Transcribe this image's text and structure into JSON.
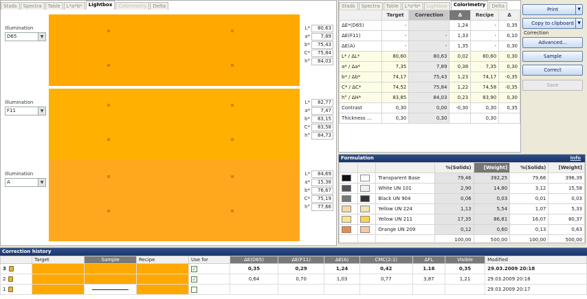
{
  "left_tabs": [
    {
      "label": "Stads",
      "state": "normal"
    },
    {
      "label": "Spectra",
      "state": "normal"
    },
    {
      "label": "Table",
      "state": "normal"
    },
    {
      "label": "L*a*b*",
      "state": "normal"
    },
    {
      "label": "Lightbox",
      "state": "active"
    },
    {
      "label": "Colorimetry",
      "state": "disabled"
    },
    {
      "label": "Delta",
      "state": "normal"
    }
  ],
  "right_tabs": [
    {
      "label": "Stads",
      "state": "normal"
    },
    {
      "label": "Spectra",
      "state": "normal"
    },
    {
      "label": "Table",
      "state": "normal"
    },
    {
      "label": "L*a*b*",
      "state": "normal"
    },
    {
      "label": "Lightbox",
      "state": "disabled"
    },
    {
      "label": "Colorimetry",
      "state": "active"
    },
    {
      "label": "Delta",
      "state": "normal"
    }
  ],
  "illuminants": [
    {
      "label": "Illumination",
      "value": "D65",
      "color": "#ffa800",
      "lab": [
        {
          "k": "L*",
          "v": "80,63"
        },
        {
          "k": "a*",
          "v": "7,89"
        },
        {
          "k": "b*",
          "v": "75,43"
        },
        {
          "k": "C*",
          "v": "75,84"
        },
        {
          "k": "h°",
          "v": "84,03"
        }
      ]
    },
    {
      "label": "Illumination",
      "value": "F11",
      "color": "#ffb000",
      "lab": [
        {
          "k": "L*",
          "v": "82,77"
        },
        {
          "k": "a*",
          "v": "7,47"
        },
        {
          "k": "b*",
          "v": "83,15"
        },
        {
          "k": "C*",
          "v": "83,58"
        },
        {
          "k": "h°",
          "v": "84,73"
        }
      ]
    },
    {
      "label": "Illumination",
      "value": "A",
      "color": "#ffa81e",
      "lab": [
        {
          "k": "L*",
          "v": "84,69"
        },
        {
          "k": "a*",
          "v": "15,38"
        },
        {
          "k": "b*",
          "v": "76,67"
        },
        {
          "k": "C*",
          "v": "75,19"
        },
        {
          "k": "h°",
          "v": "77,66"
        }
      ]
    }
  ],
  "colorimetry": {
    "headers": [
      "",
      "Target",
      "Correction",
      "Δ",
      "Recipe",
      "Δ"
    ],
    "rows": [
      {
        "label": "ΔE*(D65)",
        "target": "-",
        "corr": "",
        "d1": "1,24",
        "recipe": "-",
        "d2": "0,35",
        "hl": false
      },
      {
        "label": "ΔE(F11)",
        "target": "-",
        "corr": "-",
        "d1": "1,33",
        "recipe": "-",
        "d2": "0,10",
        "hl": false
      },
      {
        "label": "ΔE(A)",
        "target": "-",
        "corr": "-",
        "d1": "1,35",
        "recipe": "-",
        "d2": "0,30",
        "hl": false
      },
      {
        "label": "L* / ΔL*",
        "target": "80,60",
        "corr": "80,63",
        "d1": "0,02",
        "recipe": "80,60",
        "d2": "0,30",
        "hl": true
      },
      {
        "label": "a* / Δa*",
        "target": "7,35",
        "corr": "7,89",
        "d1": "0,38",
        "recipe": "7,35",
        "d2": "0,30",
        "hl": true
      },
      {
        "label": "b* / Δb*",
        "target": "74,17",
        "corr": "75,43",
        "d1": "1,23",
        "recipe": "74,17",
        "d2": "-0,35",
        "hl": true
      },
      {
        "label": "C* / ΔC*",
        "target": "74,52",
        "corr": "75,84",
        "d1": "1,22",
        "recipe": "74,58",
        "d2": "-0,35",
        "hl": true
      },
      {
        "label": "h° / ΔH*",
        "target": "83,85",
        "corr": "84,03",
        "d1": "0,23",
        "recipe": "83,90",
        "d2": "0,30",
        "hl": true
      },
      {
        "label": "Contrast",
        "target": "0,30",
        "corr": "0,00",
        "d1": "-0,30",
        "recipe": "0,30",
        "d2": "0,35",
        "hl": false
      },
      {
        "label": "Thickness ...",
        "target": "0,30",
        "corr": "0,30",
        "d1": "",
        "recipe": "0,30",
        "d2": "",
        "hl": false
      }
    ]
  },
  "buttons": [
    {
      "label": "Print",
      "dropdown": true,
      "disabled": false
    },
    {
      "label": "Copy to clipboard",
      "dropdown": true,
      "disabled": false
    },
    {
      "label": "Advanced...",
      "dropdown": false,
      "disabled": false
    },
    {
      "label": "Sample",
      "dropdown": false,
      "disabled": false
    },
    {
      "label": "Correct",
      "dropdown": false,
      "disabled": false
    },
    {
      "label": "Save",
      "dropdown": false,
      "disabled": true
    }
  ],
  "correction_label": "Correction",
  "formulation": {
    "title": "Formulation",
    "info": "Info",
    "headers": [
      "",
      "",
      "",
      "%(Solids)",
      "[Weight]",
      "%(Solids)",
      "[Weight]"
    ],
    "rows": [
      {
        "c1": "#111111",
        "c2": "#ffffff",
        "name": "Transparent Base",
        "s1": "79,46",
        "w1": "392,25",
        "s2": "79,66",
        "w2": "396,39"
      },
      {
        "c1": "#555555",
        "c2": "#f0f0f0",
        "name": "White UN 101",
        "s1": "2,90",
        "w1": "14,80",
        "s2": "3,12",
        "w2": "15,58"
      },
      {
        "c1": "#777777",
        "c2": "#333333",
        "name": "Black UN 904",
        "s1": "0,06",
        "w1": "0,03",
        "s2": "0,01",
        "w2": "0,03"
      },
      {
        "c1": "#f6d8a8",
        "c2": "#f2e3b5",
        "name": "Yellow UN 224",
        "s1": "1,13",
        "w1": "5,54",
        "s2": "1,07",
        "w2": "5,33"
      },
      {
        "c1": "#f9e58a",
        "c2": "#ffd34a",
        "name": "Yellow UN 211",
        "s1": "17,35",
        "w1": "86,81",
        "s2": "16,07",
        "w2": "80,37"
      },
      {
        "c1": "#ee8a4a",
        "c2": "#f6c9a0",
        "name": "Orange UN 209",
        "s1": "0,12",
        "w1": "0,60",
        "s2": "0,13",
        "w2": "0,63"
      }
    ],
    "totals": {
      "s1": "100,00",
      "w1": "500,00",
      "s2": "100,00",
      "w2": "500,00"
    }
  },
  "history": {
    "title": "Correction history",
    "headers": [
      "",
      "Target",
      "Sample",
      "Recipe",
      "Use for",
      "ΔE(D65)",
      "ΔE(F11)",
      "ΔE(A)",
      "CMC(2:1)",
      "ΔFL",
      "Visible",
      "Modified"
    ],
    "rows": [
      {
        "n": "3",
        "checked": true,
        "d65": "0,35",
        "f11": "0,29",
        "a": "1,24",
        "cmc": "0,42",
        "fl": "1.16",
        "vis": "0,35",
        "mod": "29.03.2009 20:18",
        "bold": true
      },
      {
        "n": "2",
        "checked": true,
        "d65": "0,64",
        "f11": "0,70",
        "a": "1,03",
        "cmc": "0,77",
        "fl": "3,87",
        "vis": "1,21",
        "mod": "29.03.2009 20:18",
        "bold": false
      },
      {
        "n": "1",
        "checked": false,
        "d65": "",
        "f11": "",
        "a": "",
        "cmc": "",
        "fl": "",
        "vis": "",
        "mod": "29.03.2009 20:17",
        "bold": false
      }
    ]
  }
}
